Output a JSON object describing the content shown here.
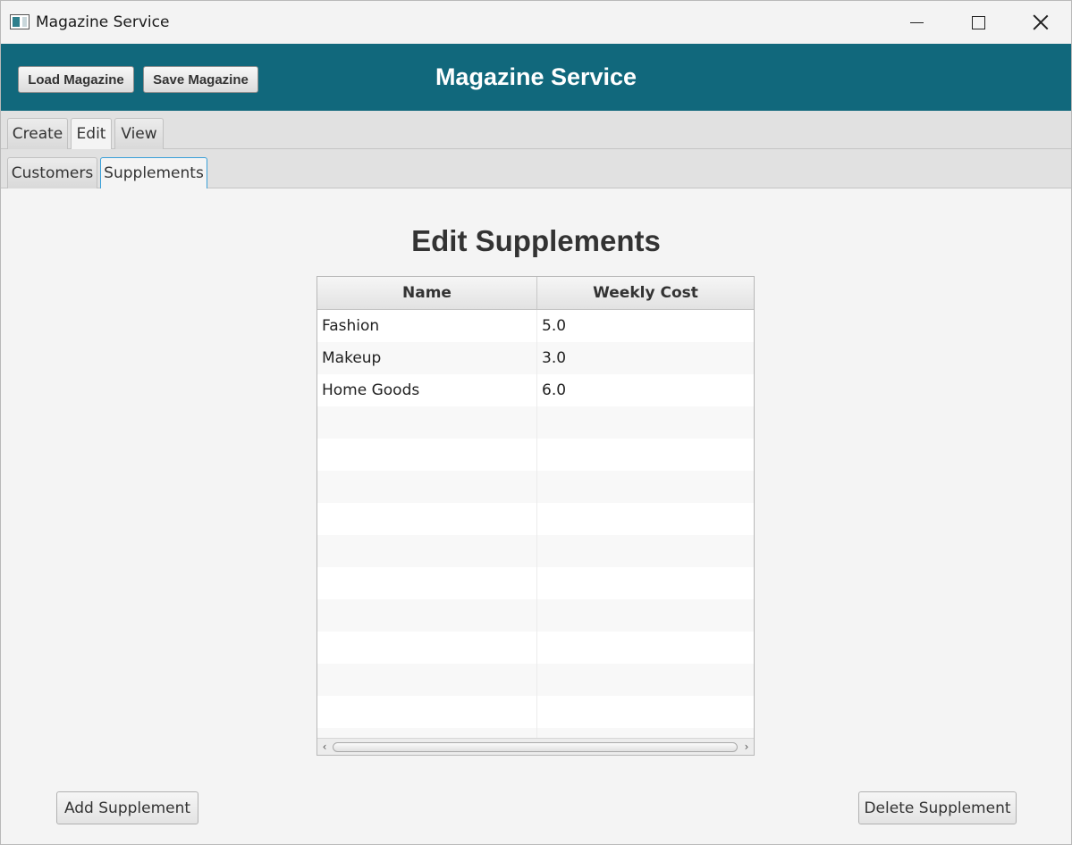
{
  "window": {
    "title": "Magazine Service",
    "controls": {
      "minimize": "minimize-icon",
      "maximize": "maximize-icon",
      "close": "close-icon"
    }
  },
  "header": {
    "title": "Magazine Service",
    "load_label": "Load Magazine",
    "save_label": "Save Magazine",
    "background_color": "#11687c"
  },
  "main_tabs": [
    {
      "label": "Create",
      "selected": false
    },
    {
      "label": "Edit",
      "selected": true
    },
    {
      "label": "View",
      "selected": false
    }
  ],
  "sub_tabs": [
    {
      "label": "Customers",
      "selected": false
    },
    {
      "label": "Supplements",
      "selected": true
    }
  ],
  "content": {
    "title": "Edit Supplements",
    "table": {
      "columns": [
        "Name",
        "Weekly Cost"
      ],
      "rows": [
        [
          "Fashion",
          "5.0"
        ],
        [
          "Makeup",
          "3.0"
        ],
        [
          "Home Goods",
          "6.0"
        ]
      ]
    },
    "add_label": "Add Supplement",
    "delete_label": "Delete Supplement"
  }
}
